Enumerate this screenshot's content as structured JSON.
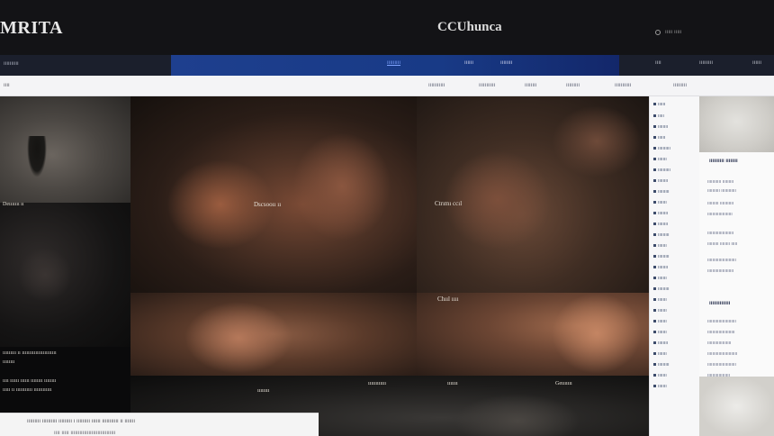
{
  "header": {
    "logo_left": "MRITA",
    "logo_center": "CCUhunca",
    "account_text": "ııııı ııııı"
  },
  "nav": {
    "left_label": "ıııııııııı",
    "items": [
      "ııııııııı",
      "ıııııı",
      "ıııııııı"
    ],
    "active_index": 0,
    "right_items": [
      "ıııı",
      "ııııııııı",
      "ıııııı"
    ]
  },
  "subnav": {
    "left_label": "ıııı",
    "items": [
      "ııııııııııı",
      "ııııııııııı",
      "ıııııııı",
      "ııııııııı",
      "ııııııııııı",
      "ııııııııı"
    ]
  },
  "gallery": {
    "captions": [
      "Dscsooıı ıı",
      "Ctrımı ccıl",
      "Chııl ıııı",
      "ıııııııı",
      "ıııııııııııı",
      "ııııııı",
      "Geııııııı"
    ],
    "left_caption": "Deııııııı ıı",
    "desc_lines": [
      "ııııııııı ıı ııııııııııııııııııııııı",
      "ıııııııı",
      "ıııı ıııııı ıııııı ıııııııı ıııııııı",
      "ııııı ıı ııııııııııı ıııııııııııı"
    ]
  },
  "card": {
    "line1": "ııııııııı ıııııııııı ııııııııı ı ııııııııı ıııııı ııııııııııı ıı ııııııı",
    "line2": "ıııı ııııı ıııııııııııııııııııııııııııııı"
  },
  "sidebar": {
    "items": [
      "ıııııı",
      "ııııı",
      "ıııııııı",
      "ıııııı",
      "ıııııııııı",
      "ııııııı",
      "ıııııııııı",
      "ıııııııı",
      "ııııııııı",
      "ııııııı",
      "ıııııııı",
      "ıııııııı",
      "ııııııııı",
      "ııııııı",
      "ııııııııı",
      "ıııııııı",
      "ııııııı",
      "ııııııııı",
      "ııııııı",
      "ııııııı",
      "ııııııı",
      "ııııııı",
      "ıııııııı",
      "ııııııı",
      "ııııııııı",
      "ııııııı",
      "ııııııı"
    ]
  },
  "rightcol": {
    "headline1": "ıııııııııı ıııııııı",
    "lines1": [
      "ııııııııııı ııııııııı",
      "ıııııııııı ıııııııııııı",
      "ııııııııı ııııııııııı",
      "ıııııııııııııııııııı",
      "ııııııııııııııııııııı",
      "ııııııııı ıııııııı ııııı",
      "ııııııııııııııııııııııı",
      "ııııııııııııııııııııı"
    ],
    "headline2": "ıııııııııııııı",
    "lines2": [
      "ııııııııııııııııııııııı",
      "ıııııııııııııııııııııı",
      "ııııııııııııııııııı",
      "ıııııııııııııııııııııııı",
      "ııııııııııııııııııııııı",
      "ıııııııııııııııııı"
    ]
  }
}
